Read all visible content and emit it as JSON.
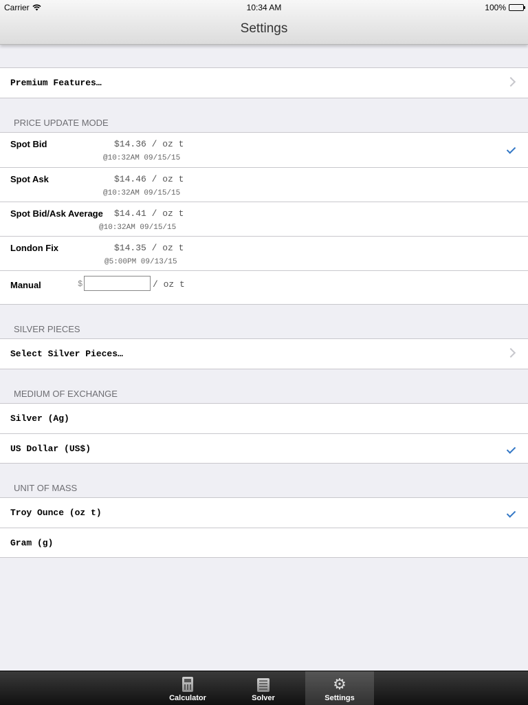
{
  "status_bar": {
    "carrier": "Carrier",
    "time": "10:34 AM",
    "battery": "100%"
  },
  "nav": {
    "title": "Settings"
  },
  "premium": {
    "label": "Premium Features…"
  },
  "price_update": {
    "header": "PRICE UPDATE MODE",
    "rows": [
      {
        "name": "Spot Bid",
        "value": "$14.36 / oz t",
        "time": "@10:32AM 09/15/15",
        "selected": true
      },
      {
        "name": "Spot Ask",
        "value": "$14.46 / oz t",
        "time": "@10:32AM 09/15/15",
        "selected": false
      },
      {
        "name": "Spot Bid/Ask Average",
        "value": "$14.41 / oz t",
        "time": "@10:32AM 09/15/15",
        "selected": false
      },
      {
        "name": "London Fix",
        "value": "$14.35 / oz t",
        "time": "@5:00PM 09/13/15",
        "selected": false
      }
    ],
    "manual": {
      "name": "Manual",
      "currency": "$",
      "value": "",
      "unit": "/ oz t"
    }
  },
  "silver_pieces": {
    "header": "SILVER PIECES",
    "label": "Select Silver Pieces…"
  },
  "medium": {
    "header": "MEDIUM OF EXCHANGE",
    "options": [
      {
        "label": "Silver (Ag)",
        "selected": false
      },
      {
        "label": "US Dollar (US$)",
        "selected": true
      }
    ]
  },
  "mass": {
    "header": "UNIT OF MASS",
    "options": [
      {
        "label": "Troy Ounce (oz t)",
        "selected": true
      },
      {
        "label": "Gram (g)",
        "selected": false
      }
    ]
  },
  "tabs": [
    {
      "label": "Calculator",
      "icon": "calculator-icon",
      "selected": false
    },
    {
      "label": "Solver",
      "icon": "solver-icon",
      "selected": false
    },
    {
      "label": "Settings",
      "icon": "gear-icon",
      "selected": true
    }
  ],
  "colors": {
    "accent": "#3478c6",
    "background": "#efeff4",
    "tab_bar": "#1a1a1a"
  }
}
